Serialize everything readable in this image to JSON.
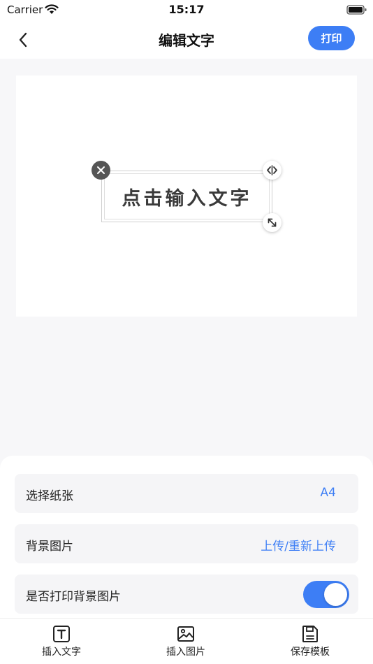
{
  "status_bar": {
    "carrier": "Carrier",
    "time": "15:17"
  },
  "nav": {
    "title": "编辑文字",
    "print_label": "打印"
  },
  "canvas": {
    "placeholder_text": "点击输入文字"
  },
  "settings": {
    "paper": {
      "label": "选择纸张",
      "value": "A4"
    },
    "background": {
      "label": "背景图片",
      "value": "上传/重新上传"
    },
    "print_background": {
      "label": "是否打印背景图片",
      "enabled": true
    }
  },
  "tabs": [
    {
      "label": "插入文字",
      "icon": "text-icon"
    },
    {
      "label": "插入图片",
      "icon": "image-icon"
    },
    {
      "label": "保存模板",
      "icon": "save-icon"
    }
  ],
  "colors": {
    "accent": "#3d7ef5",
    "background": "#f7f7f9",
    "row": "#f5f5f7"
  }
}
